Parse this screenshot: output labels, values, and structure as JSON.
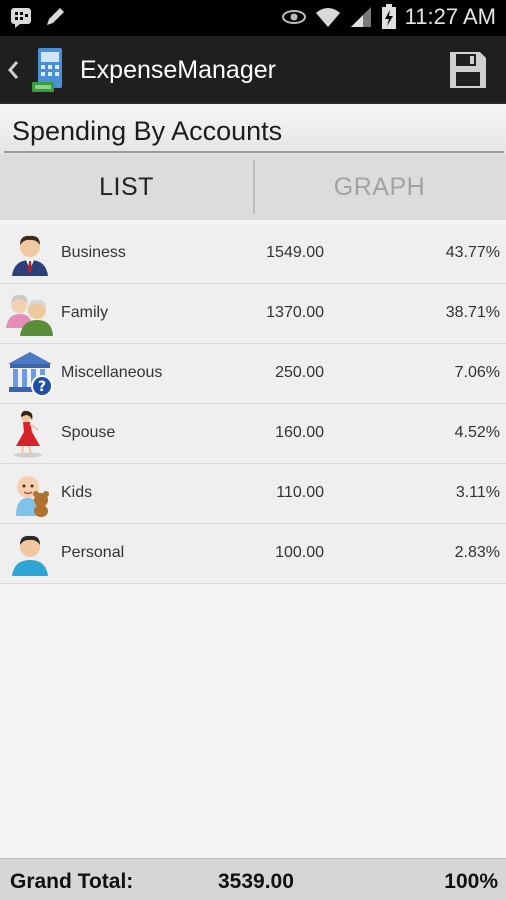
{
  "status_bar": {
    "time": "11:27 AM",
    "icons": [
      "bbm-icon",
      "pencil-icon",
      "eye-icon",
      "wifi-icon",
      "signal-icon",
      "battery-charging-icon"
    ]
  },
  "action_bar": {
    "title": "ExpenseManager",
    "icons": [
      "back-chevron-icon",
      "app-icon",
      "save-icon"
    ]
  },
  "heading": "Spending By Accounts",
  "tabs": [
    {
      "label": "LIST",
      "active": true
    },
    {
      "label": "GRAPH",
      "active": false
    }
  ],
  "accounts": [
    {
      "name": "Business",
      "amount": "1549.00",
      "percent": "43.77%",
      "icon": "businessman-icon"
    },
    {
      "name": "Family",
      "amount": "1370.00",
      "percent": "38.71%",
      "icon": "family-icon"
    },
    {
      "name": "Miscellaneous",
      "amount": "250.00",
      "percent": "7.06%",
      "icon": "bank-question-icon"
    },
    {
      "name": "Spouse",
      "amount": "160.00",
      "percent": "4.52%",
      "icon": "woman-dress-icon"
    },
    {
      "name": "Kids",
      "amount": "110.00",
      "percent": "3.11%",
      "icon": "baby-teddy-icon"
    },
    {
      "name": "Personal",
      "amount": "100.00",
      "percent": "2.83%",
      "icon": "person-icon"
    }
  ],
  "footer": {
    "label": "Grand Total:",
    "amount": "3539.00",
    "percent": "100%"
  },
  "colors": {
    "status_bar_bg": "#000000",
    "action_bar_bg": "#1f1f1f",
    "list_bg": "#efefef",
    "footer_bg": "#d6d6d6"
  }
}
